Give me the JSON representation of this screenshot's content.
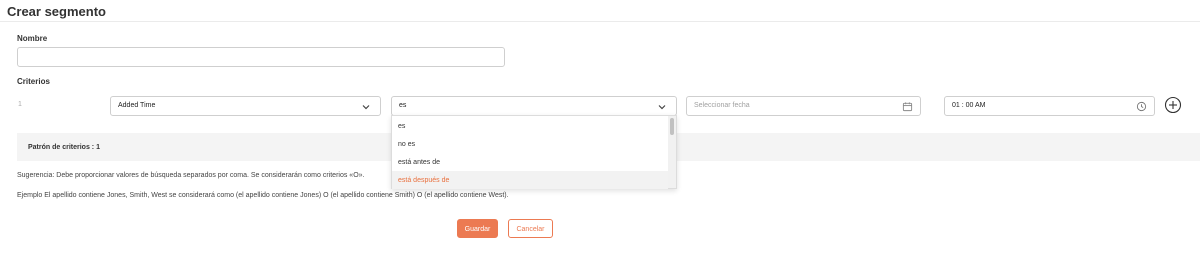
{
  "header": {
    "title": "Crear segmento"
  },
  "form": {
    "name_label": "Nombre",
    "name_value": "",
    "criteria_label": "Criterios"
  },
  "criteria_row": {
    "number": "1",
    "field_value": "Added Time",
    "operator_value": "es",
    "date_placeholder": "Seleccionar fecha",
    "time_value": "01 : 00 AM"
  },
  "operator_options": [
    {
      "label": "es"
    },
    {
      "label": "no es"
    },
    {
      "label": "está antes de"
    },
    {
      "label": "está después de"
    }
  ],
  "pattern": {
    "label": "Patrón de criterios : 1"
  },
  "hints": {
    "suggestion": "Sugerencia: Debe proporcionar valores de búsqueda separados por coma. Se considerarán como criterios «O».",
    "example": "Ejemplo  El apellido contiene Jones, Smith, West se considerará como (el apellido contiene Jones) O (el apellido contiene Smith) O (el apellido contiene West)."
  },
  "buttons": {
    "save": "Guardar",
    "cancel": "Cancelar"
  },
  "colors": {
    "accent": "#ec7a52",
    "hover_text": "#e9703e"
  },
  "icons": {
    "select_chevron": "chevron-down-icon",
    "date": "calendar-icon",
    "time": "clock-icon",
    "add": "plus-circle-icon"
  }
}
